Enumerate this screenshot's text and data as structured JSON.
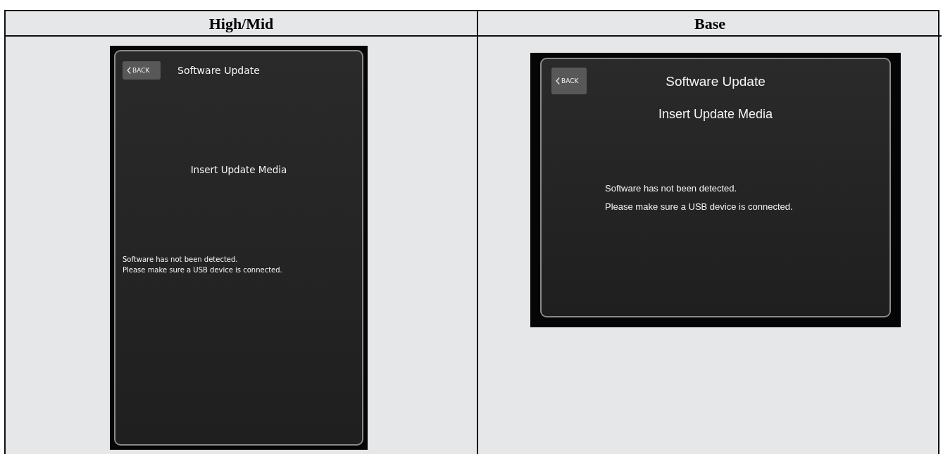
{
  "columns": [
    {
      "heading": "High/Mid",
      "screen": {
        "kind": "portrait",
        "back_button": "BACK",
        "title": "Software Update",
        "heading": "Insert Update Media",
        "message_lines": [
          "Software has not been detected.",
          "Please make sure a USB device is connected."
        ]
      }
    },
    {
      "heading": "Base",
      "screen": {
        "kind": "landscape",
        "back_button": "BACK",
        "title": "Software Update",
        "heading": "Insert Update Media",
        "message_lines": [
          "Software has not been detected.",
          "Please make sure a USB device is connected."
        ]
      }
    }
  ]
}
